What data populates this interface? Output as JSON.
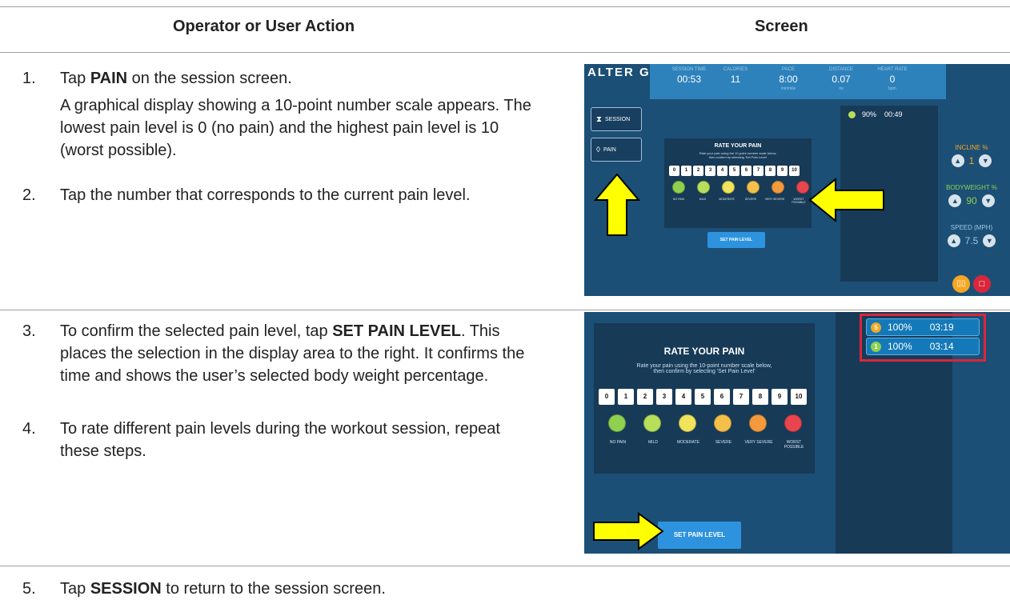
{
  "table": {
    "header_action": "Operator or User Action",
    "header_screen": "Screen"
  },
  "steps": [
    {
      "num": "1.",
      "pre": "Tap ",
      "bold": "PAIN",
      "post": " on the session screen."
    },
    {
      "num": "2.",
      "text": "Tap the number that corresponds to the current pain level."
    },
    {
      "num": "3.",
      "pre": "To confirm the selected pain level, tap ",
      "bold": "SET PAIN LEVEL",
      "post": ". This places the selection in the display area to the right. It confirms the time and shows the user’s selected body weight percentage."
    },
    {
      "num": "4.",
      "text": "To rate different pain levels during the workout session, repeat these steps."
    },
    {
      "num": "5.",
      "pre": "Tap ",
      "bold": "SESSION",
      "post": " to return to the session screen."
    }
  ],
  "step1_note": "A graphical display showing a 10-point number scale appears. The lowest pain level is 0 (no pain) and the highest pain level is 10 (worst possible).",
  "screen1": {
    "logo": "ALTER G",
    "stats": [
      {
        "label": "SESSION TIME",
        "value": "00:53",
        "unit": ""
      },
      {
        "label": "CALORIES",
        "value": "11",
        "unit": ""
      },
      {
        "label": "PACE",
        "value": "8:00",
        "unit": "min/mile"
      },
      {
        "label": "DISTANCE",
        "value": "0.07",
        "unit": "mi"
      },
      {
        "label": "HEART RATE",
        "value": "0",
        "unit": "bpm"
      }
    ],
    "nav_session": "SESSION",
    "nav_pain": "PAIN",
    "entry_pct": "90%",
    "entry_time": "00:49",
    "incline_label": "INCLINE %",
    "incline_value": "1",
    "bodyweight_label": "BODYWEIGHT %",
    "bodyweight_value": "90",
    "speed_label": "SPEED (MPH)",
    "speed_value": "7.5"
  },
  "rate": {
    "title": "RATE YOUR PAIN",
    "instruction_1": "Rate your pain using the 10-point number scale below,",
    "instruction_2": "then confirm by selecting 'Set Pain Level'",
    "numbers": [
      "0",
      "1",
      "2",
      "3",
      "4",
      "5",
      "6",
      "7",
      "8",
      "9",
      "10"
    ],
    "faces": [
      {
        "color": "#8fd14f"
      },
      {
        "color": "#b7df5a"
      },
      {
        "color": "#f1e35a"
      },
      {
        "color": "#f5c04a"
      },
      {
        "color": "#f39a3c"
      },
      {
        "color": "#e8454f"
      }
    ],
    "face_labels": [
      "NO PAIN",
      "MILD",
      "MODERATE",
      "SEVERE",
      "VERY SEVERE",
      "WORST POSSIBLE"
    ],
    "set_button": "SET PAIN LEVEL"
  },
  "screen2": {
    "entries": [
      {
        "badge": "5",
        "pct": "100%",
        "time": "03:19",
        "badge_color": "#f5a623"
      },
      {
        "badge": "1",
        "pct": "100%",
        "time": "03:14",
        "badge_color": "#8fd14f"
      }
    ]
  },
  "colors": {
    "arrow": "#ffff00",
    "highlight_box": "#d9263a"
  }
}
